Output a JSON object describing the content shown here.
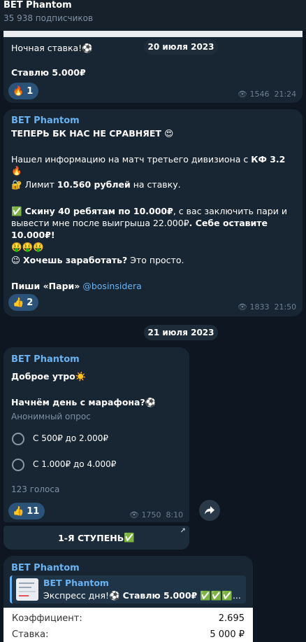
{
  "header": {
    "title": "BET Phantom",
    "subscribers": "35 938 подписчиков"
  },
  "msg1": {
    "date_pill": "20 июля 2023",
    "line1": "Ночная ставка!",
    "line2": "Ставлю 5.000₽",
    "reaction": {
      "emoji_icon": "fire-icon",
      "count": "1"
    },
    "views": "1546",
    "time": "21:24"
  },
  "msg2": {
    "channel": "BET Phantom",
    "headline": "ТЕПЕРЬ БК НАС НЕ СРАВНЯЕТ",
    "p1_text": "Нашел информацию на матч третьего дивизиона с ",
    "p1_bold": "КФ 3.2",
    "p2_pre": "Лимит ",
    "p2_bold": "10.560 рублей",
    "p2_post": " на ставку.",
    "p3_bold1": "Скину 40 ребятам по 10.000₽",
    "p3_text": ", с вас заключить пари и вывести мне после выигрыша 22.000₽",
    "p3_bold2": ". Себе оставите 10.000₽!",
    "p4_bold": "Хочешь заработать?",
    "p4_text": " Это просто.",
    "p5_bold": "Пиши «Пари»",
    "p5_link": "@bosinsidera",
    "reaction": {
      "emoji_icon": "thumbs-up-icon",
      "count": "2"
    },
    "views": "1833",
    "time": "21:50"
  },
  "date_pill_2": "21 июля 2023",
  "msg3": {
    "channel": "BET Phantom",
    "line1": "Доброе утро",
    "line2": "Начнём день с марафона?",
    "poll_type": "Анонимный опрос",
    "options": [
      "С 500₽ до 2.000₽",
      "С 1.000₽ до 4.000₽"
    ],
    "votes": "123 голоса",
    "reaction": {
      "emoji_icon": "thumbs-up-icon",
      "count": "11"
    },
    "views": "1750",
    "time": "8:10",
    "button": "1-Я СТУПЕНЬ"
  },
  "msg4": {
    "channel": "BET Phantom",
    "reply_name": "BET Phantom",
    "reply_text": "Экспресс дня!",
    "reply_bold": "Ставлю 5.000₽",
    "rows": [
      {
        "label": "Коэффициент:",
        "value": "2.695"
      },
      {
        "label": "Ставка:",
        "value": "5 000 ₽"
      }
    ]
  }
}
